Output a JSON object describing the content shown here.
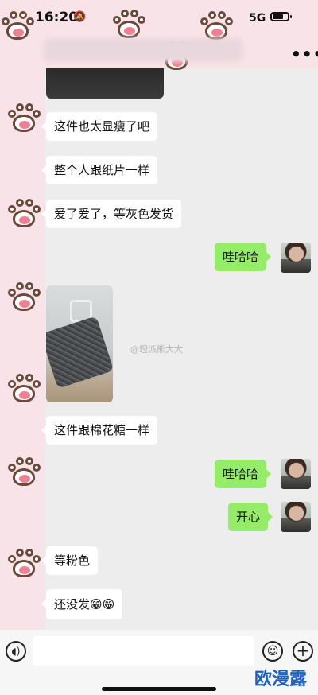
{
  "status_bar": {
    "time": "16:20",
    "mute_icon": "bell-slash-icon",
    "network": "5G",
    "battery_icon": "battery-icon"
  },
  "header": {
    "more_label": "•••"
  },
  "messages": [
    {
      "side": "left",
      "text": "这件也太显瘦了吧"
    },
    {
      "side": "left",
      "text": "整个人跟纸片一样"
    },
    {
      "side": "left",
      "text": "爱了爱了，等灰色发货"
    },
    {
      "side": "right",
      "text": "哇哈哈"
    },
    {
      "side": "left",
      "text": "这件跟棉花糖一样"
    },
    {
      "side": "right",
      "text": "哇哈哈"
    },
    {
      "side": "right",
      "text": "开心"
    },
    {
      "side": "left",
      "text": "等粉色"
    },
    {
      "side": "left",
      "text": "还没发😁😁"
    }
  ],
  "watermark": "@理派熊大大",
  "input_bar": {
    "voice_icon": "voice-icon",
    "emoji_icon": "emoji-icon",
    "plus_icon": "plus-icon",
    "placeholder": ""
  },
  "brand": "欧漫露",
  "colors": {
    "bubble_right": "#95ec69",
    "bubble_left": "#ffffff",
    "background": "#ededed",
    "paw_pink": "#f07f93"
  }
}
